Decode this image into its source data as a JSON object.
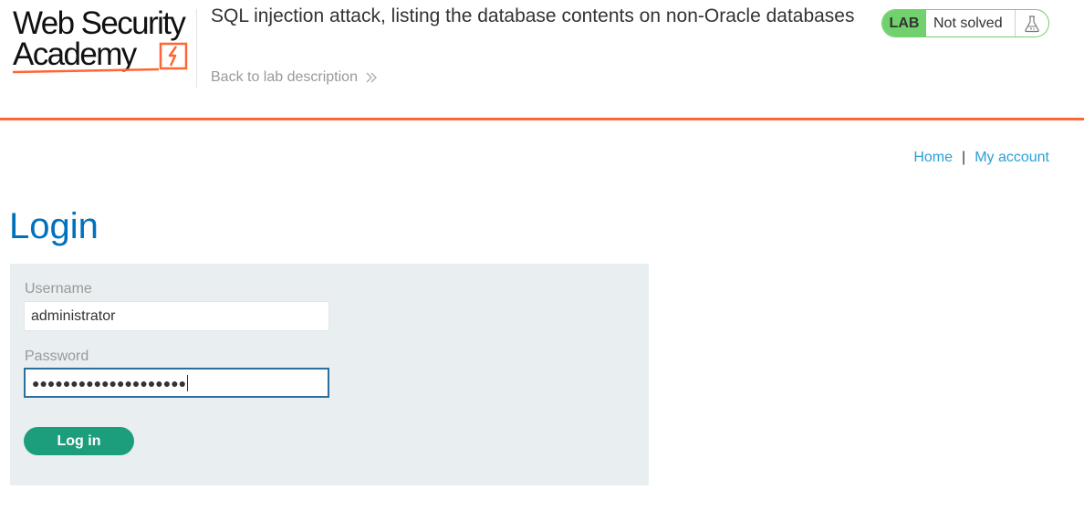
{
  "header": {
    "logo_line1": "Web Security",
    "logo_line2": "Academy",
    "lab_title": "SQL injection attack, listing the database contents on non-Oracle databases",
    "back_link": "Back to lab description",
    "status_tag": "LAB",
    "status_text": "Not solved",
    "brand_color": "#ff6633",
    "status_color": "#70d16d"
  },
  "nav": {
    "home": "Home",
    "separator": "|",
    "my_account": "My account"
  },
  "page": {
    "title": "Login"
  },
  "form": {
    "username_label": "Username",
    "username_value": "administrator",
    "password_label": "Password",
    "password_masked": "●●●●●●●●●●●●●●●●●●●●",
    "submit_label": "Log in",
    "submit_color": "#1c9e7c"
  },
  "icons": {
    "logo_mark": "lightning-bolt-icon",
    "back_chevron": "double-chevron-right-icon",
    "status_flask": "flask-icon"
  }
}
